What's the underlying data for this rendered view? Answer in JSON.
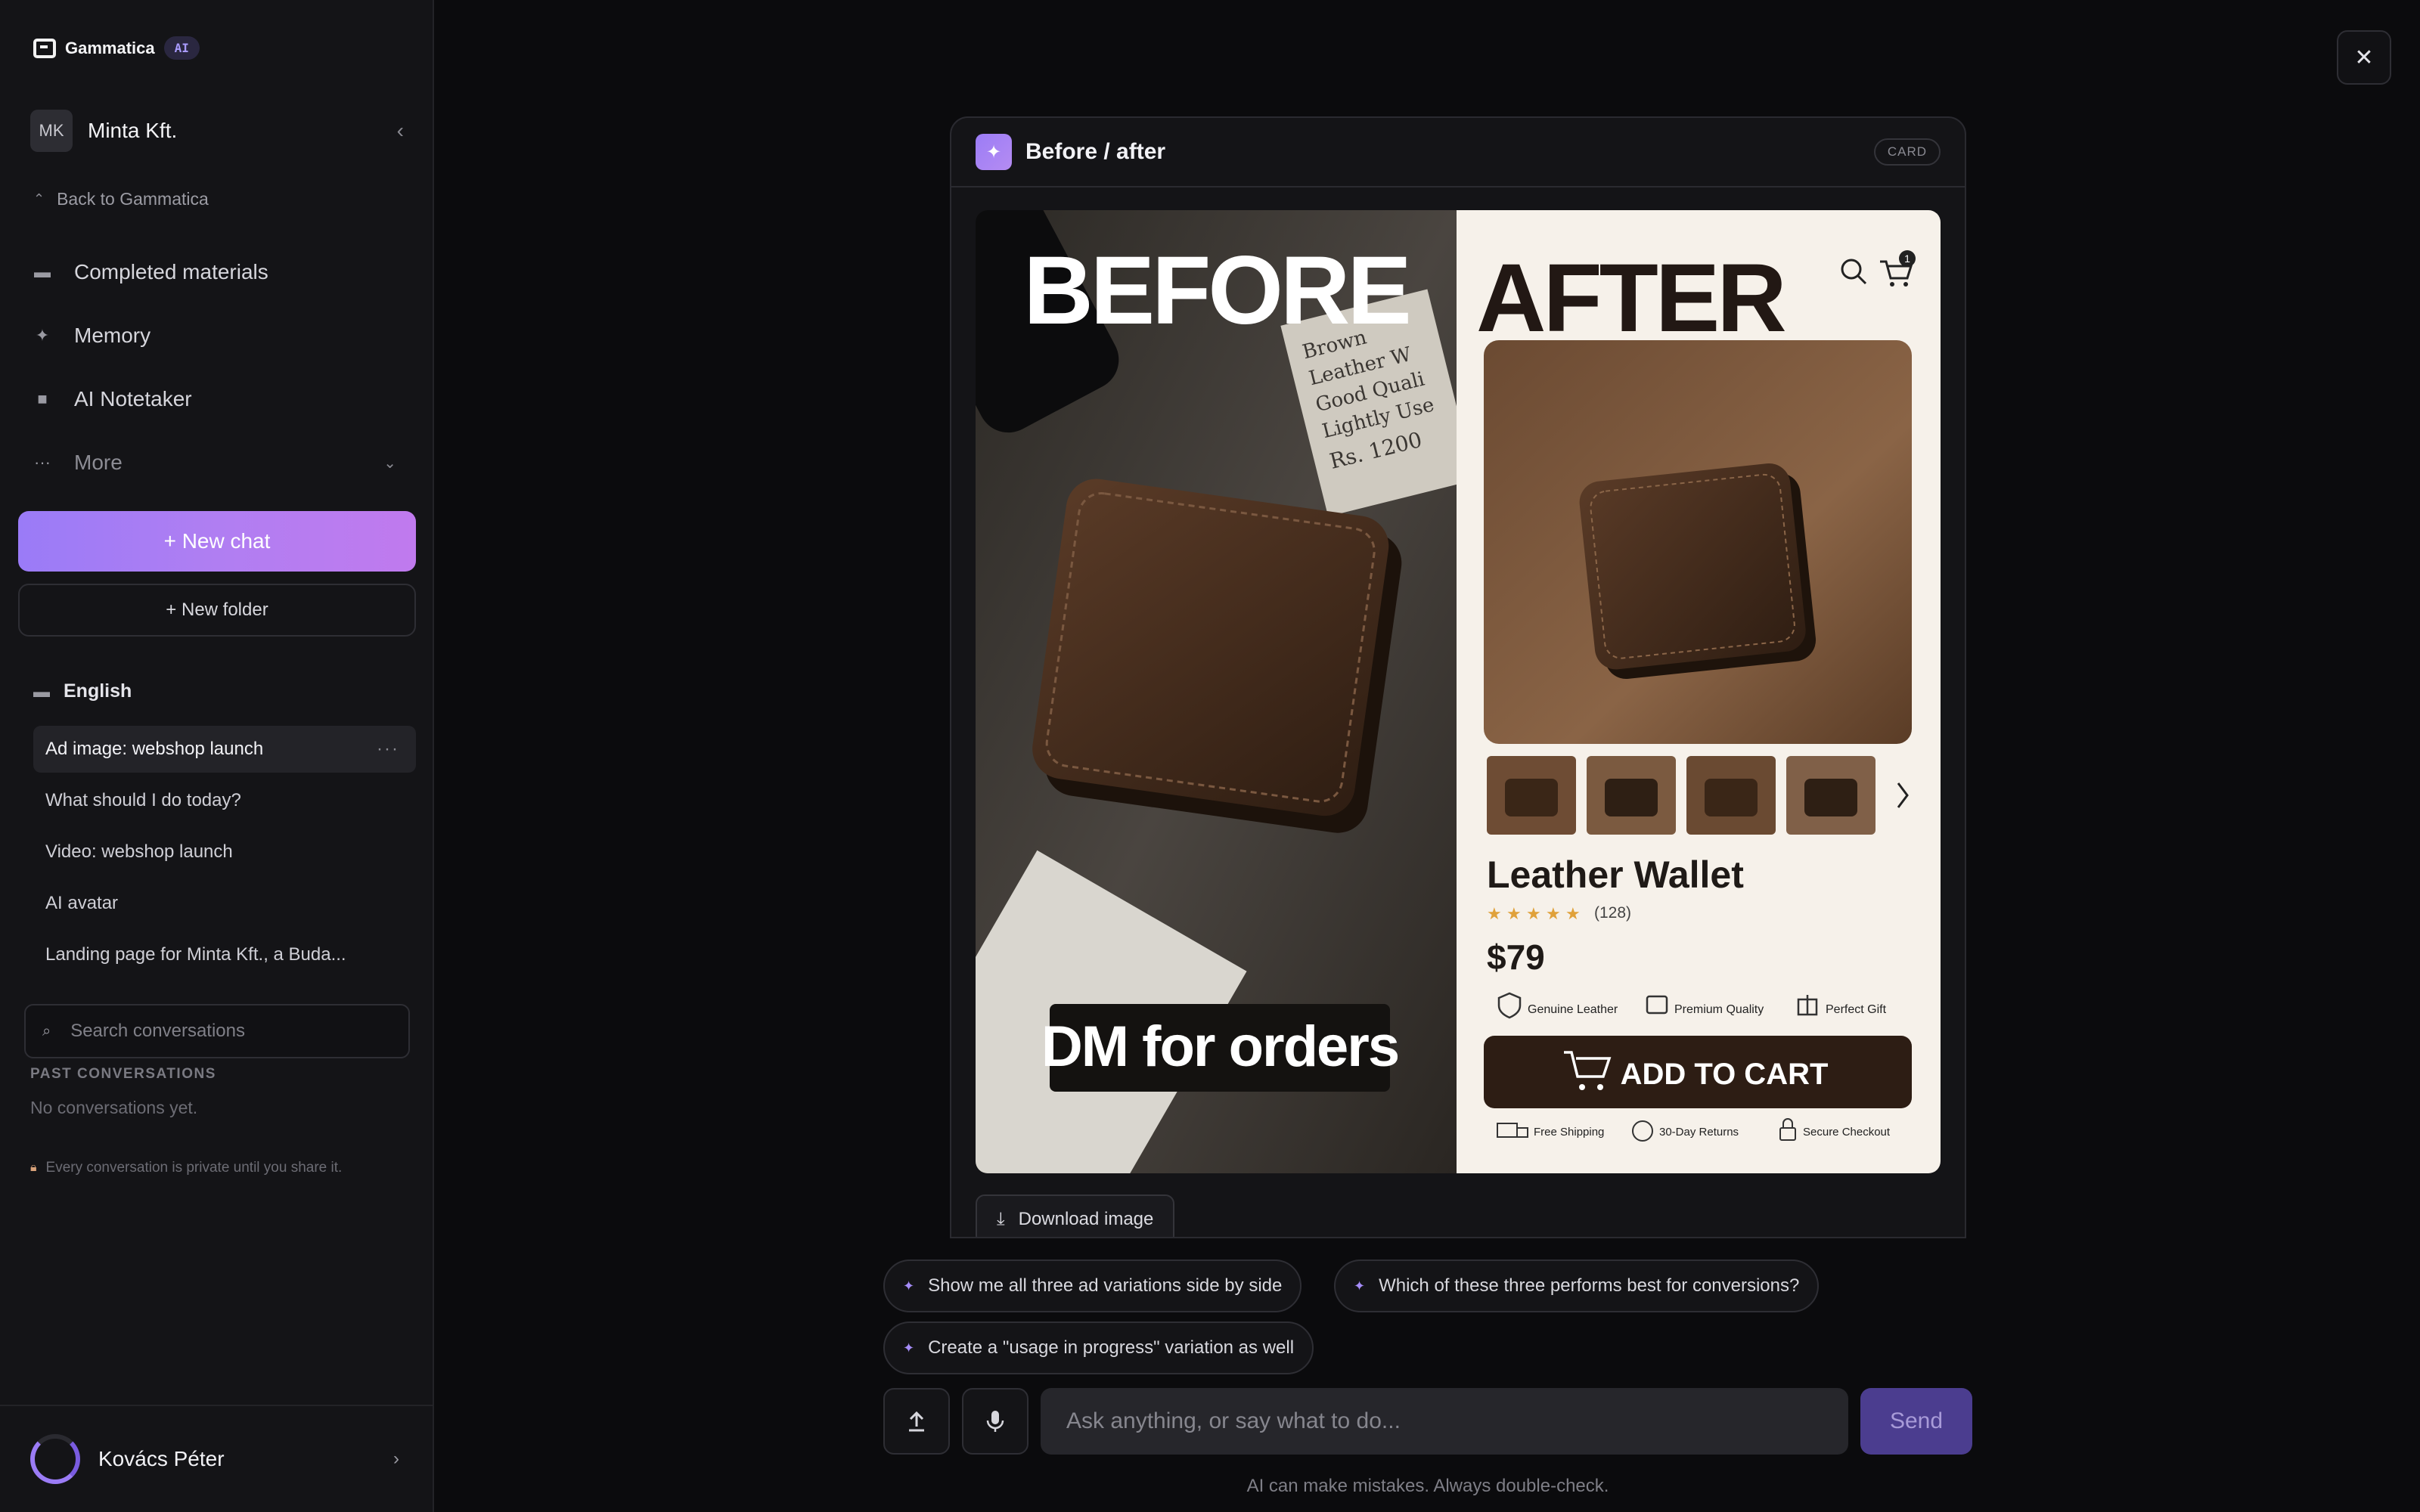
{
  "app": {
    "name": "Gammatica",
    "badge": "AI"
  },
  "workspace": {
    "initials": "MK",
    "name": "Minta Kft."
  },
  "sidebar": {
    "back_label": "Back to Gammatica",
    "nav": [
      {
        "label": "Completed materials",
        "icon": "folder-icon"
      },
      {
        "label": "Memory",
        "icon": "sparkle-icon"
      },
      {
        "label": "AI Notetaker",
        "icon": "video-icon"
      },
      {
        "label": "More",
        "icon": "ellipsis-icon"
      }
    ],
    "new_chat_label": "+ New chat",
    "new_folder_label": "+ New folder",
    "folder": {
      "name": "English",
      "conversations": [
        {
          "title": "Ad image: webshop launch",
          "active": true
        },
        {
          "title": "What should I do today?",
          "active": false
        },
        {
          "title": "Video: webshop launch",
          "active": false
        },
        {
          "title": "AI avatar",
          "active": false
        },
        {
          "title": "Landing page for Minta Kft., a Buda...",
          "active": false
        }
      ]
    },
    "search_placeholder": "Search conversations",
    "past_label": "PAST CONVERSATIONS",
    "no_conversations": "No conversations yet.",
    "privacy_note": "Every conversation is private until you share it."
  },
  "user": {
    "name": "Kovács Péter"
  },
  "card": {
    "title": "Before / after",
    "badge": "CARD",
    "download_label": "Download image",
    "image": {
      "before_heading": "BEFORE",
      "after_heading": "AFTER",
      "note_lines": [
        "Brown",
        "Leather W",
        "Good Quali",
        "Lightly Use",
        "Rs. 1200"
      ],
      "before_caption": "DM for orders",
      "cart_count": "1",
      "product_name": "Leather Wallet",
      "rating_stars": 5,
      "review_count": "(128)",
      "price": "$79",
      "features": [
        "Genuine Leather",
        "Premium Quality",
        "Perfect Gift"
      ],
      "cta": "ADD TO CART",
      "benefits": [
        "Free Shipping",
        "30-Day Returns",
        "Secure Checkout"
      ]
    }
  },
  "suggestions": [
    "Show me all three ad variations side by side",
    "Which of these three performs best for conversions?",
    "Create a \"usage in progress\" variation as well"
  ],
  "composer": {
    "placeholder": "Ask anything, or say what to do...",
    "send_label": "Send",
    "disclaimer": "AI can make mistakes. Always double-check."
  },
  "colors": {
    "accent": "#9b7cf6",
    "background": "#0b0b0d",
    "sidebar": "#141417",
    "send_disabled": "#4b3d8f"
  }
}
